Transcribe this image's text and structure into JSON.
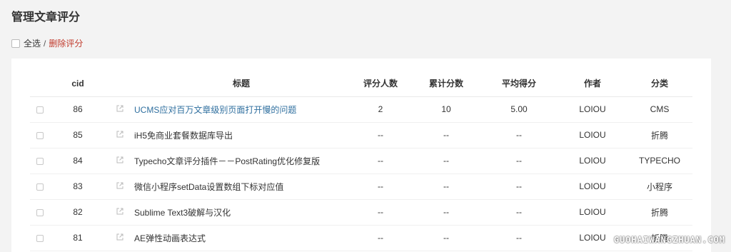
{
  "page": {
    "title": "管理文章评分"
  },
  "bulk": {
    "select_all": "全选",
    "separator": "/",
    "delete_label": "删除评分"
  },
  "table": {
    "headers": {
      "cid": "cid",
      "title": "标题",
      "raters": "评分人数",
      "total": "累计分数",
      "avg": "平均得分",
      "author": "作者",
      "category": "分类"
    },
    "rows": [
      {
        "cid": "86",
        "title": "UCMS应对百万文章级别页面打开慢的问题",
        "raters": "2",
        "total": "10",
        "avg": "5.00",
        "author": "LOIOU",
        "category": "CMS"
      },
      {
        "cid": "85",
        "title": "iH5免商业套餐数据库导出",
        "raters": "--",
        "total": "--",
        "avg": "--",
        "author": "LOIOU",
        "category": "折腾"
      },
      {
        "cid": "84",
        "title": "Typecho文章评分插件－－PostRating优化修复版",
        "raters": "--",
        "total": "--",
        "avg": "--",
        "author": "LOIOU",
        "category": "TYPECHO"
      },
      {
        "cid": "83",
        "title": "微信小程序setData设置数组下标对应值",
        "raters": "--",
        "total": "--",
        "avg": "--",
        "author": "LOIOU",
        "category": "小程序"
      },
      {
        "cid": "82",
        "title": "Sublime Text3破解与汉化",
        "raters": "--",
        "total": "--",
        "avg": "--",
        "author": "LOIOU",
        "category": "折腾"
      },
      {
        "cid": "81",
        "title": "AE弹性动画表达式",
        "raters": "--",
        "total": "--",
        "avg": "--",
        "author": "LOIOU",
        "category": "折腾"
      }
    ]
  },
  "watermark": "GUOHAIWANGZHUAN.COM",
  "colors": {
    "link": "#2f6f9f",
    "danger": "#c0392b",
    "background": "#f3f3f3"
  },
  "icons": {
    "row_link": "external-link-icon"
  }
}
